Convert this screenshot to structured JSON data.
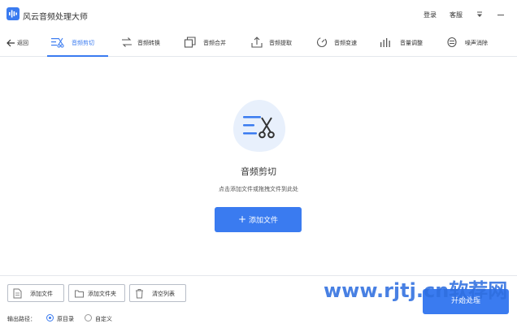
{
  "app": {
    "title": "风云音频处理大师",
    "accent_color": "#3a7bf0",
    "logo_icon": "sound-wave-icon"
  },
  "titlebar": {
    "login_label": "登录",
    "service_label": "客服",
    "menu_icon": "dropdown-menu-icon",
    "minimize_icon": "minimize-icon"
  },
  "toolbar": {
    "back_label": "返回",
    "tabs": [
      {
        "label": "音频剪切",
        "icon": "scissors-icon",
        "active": true
      },
      {
        "label": "音频转换",
        "icon": "convert-arrows-icon",
        "active": false
      },
      {
        "label": "音频合并",
        "icon": "merge-icon",
        "active": false
      },
      {
        "label": "音频提取",
        "icon": "extract-icon",
        "active": false
      },
      {
        "label": "音频变速",
        "icon": "speed-icon",
        "active": false
      },
      {
        "label": "音量调整",
        "icon": "volume-bars-icon",
        "active": false
      },
      {
        "label": "噪声消除",
        "icon": "noise-icon",
        "active": false
      }
    ]
  },
  "main": {
    "title": "音频剪切",
    "subtitle": "点击添加文件或拖拽文件到此处",
    "add_button_label": "添加文件"
  },
  "footer": {
    "add_file_label": "添加文件",
    "add_folder_label": "添加文件夹",
    "clear_list_label": "清空列表",
    "output_path_label": "输出路径：",
    "radio_original_label": "原目录",
    "radio_custom_label": "自定义",
    "selected_output": "原目录",
    "start_label": "开始处理"
  },
  "watermark": {
    "text": "www.rjtj.cn软荐网"
  }
}
